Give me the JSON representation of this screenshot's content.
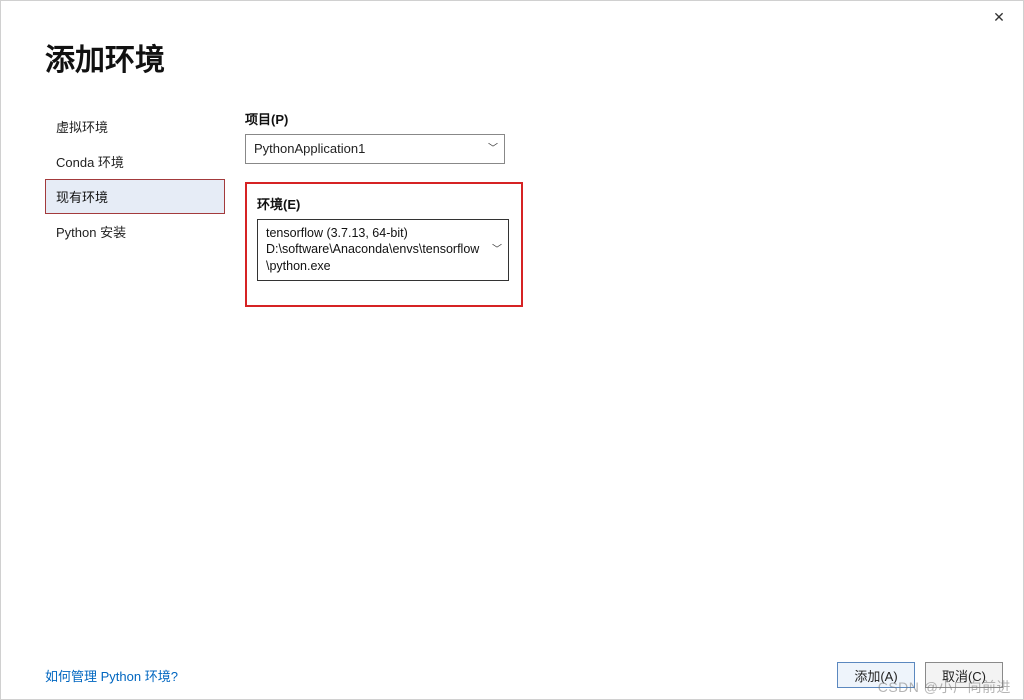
{
  "title": "添加环境",
  "close_glyph": "✕",
  "sidebar": {
    "items": [
      {
        "label": "虚拟环境"
      },
      {
        "label": "Conda 环境"
      },
      {
        "label": "现有环境"
      },
      {
        "label": "Python 安装"
      }
    ],
    "selected_index": 2
  },
  "project": {
    "label": "项目(P)",
    "value": "PythonApplication1"
  },
  "environment": {
    "label": "环境(E)",
    "value_line1": "tensorflow (3.7.13, 64-bit)",
    "value_line2": "D:\\software\\Anaconda\\envs\\tensorflow\\python.exe"
  },
  "footer": {
    "help_link": "如何管理 Python 环境?",
    "add_button": "添加(A)",
    "cancel_button": "取消(C)"
  },
  "watermark": "CSDN @小广向前进"
}
